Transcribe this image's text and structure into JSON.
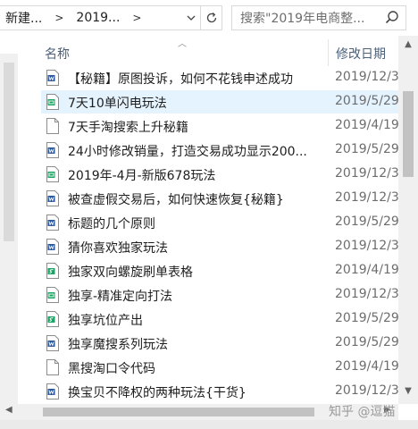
{
  "address_bar": {
    "crumbs": [
      "新建...",
      "2019..."
    ]
  },
  "search": {
    "placeholder": "搜索\"2019年电商整..."
  },
  "columns": {
    "name": "名称",
    "date": "修改日期"
  },
  "files": [
    {
      "name": "【秘籍】原图投诉，如何不花钱申述成功",
      "date": "2019/12/3",
      "type": "word",
      "selected": false
    },
    {
      "name": "7天10单闪电玩法",
      "date": "2019/5/29",
      "type": "sheet",
      "selected": true
    },
    {
      "name": "7天手淘搜索上升秘籍",
      "date": "2019/4/19",
      "type": "text",
      "selected": false
    },
    {
      "name": "24小时修改销量，打造交易成功显示200...",
      "date": "2019/5/29",
      "type": "word",
      "selected": false
    },
    {
      "name": "2019年-4月-新版678玩法",
      "date": "2019/12/3",
      "type": "sheet",
      "selected": false
    },
    {
      "name": "被查虚假交易后，如何快速恢复{秘籍}",
      "date": "2019/12/3",
      "type": "word",
      "selected": false
    },
    {
      "name": "标题的几个原则",
      "date": "2019/5/29",
      "type": "word",
      "selected": false
    },
    {
      "name": "猜你喜欢独家玩法",
      "date": "2019/12/3",
      "type": "word",
      "selected": false
    },
    {
      "name": "独家双向螺旋刷单表格",
      "date": "2019/4/19",
      "type": "sheet2",
      "selected": false
    },
    {
      "name": "独享-精准定向打法",
      "date": "2019/12/3",
      "type": "sheet",
      "selected": false
    },
    {
      "name": "独享坑位产出",
      "date": "2019/5/29",
      "type": "sheet2",
      "selected": false
    },
    {
      "name": "独享魔搜系列玩法",
      "date": "2019/5/29",
      "type": "word",
      "selected": false
    },
    {
      "name": "黑搜淘口令代码",
      "date": "2019/4/19",
      "type": "text",
      "selected": false
    },
    {
      "name": "换宝贝不降权的两种玩法{干货}",
      "date": "2019/12/3",
      "type": "word",
      "selected": false
    }
  ],
  "watermark": "知乎 @逗猫",
  "colors": {
    "selected_bg": "#e5f3ff",
    "word_icon": "#2b579a",
    "sheet_icon": "#21a366"
  }
}
